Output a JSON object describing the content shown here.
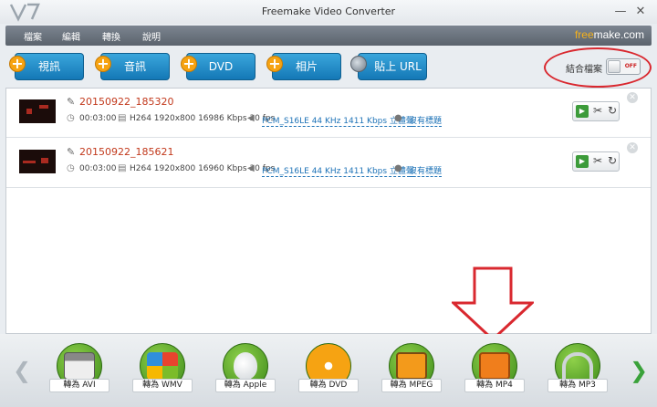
{
  "window": {
    "title": "Freemake Video Converter",
    "minimize": "—",
    "close": "✕"
  },
  "brand": {
    "part1": "free",
    "part2": "make.com"
  },
  "menu": {
    "items": [
      "檔案",
      "編輯",
      "轉換",
      "說明"
    ]
  },
  "sources": [
    {
      "label": "視訊"
    },
    {
      "label": "音訊"
    },
    {
      "label": "DVD"
    },
    {
      "label": "相片"
    },
    {
      "label": "貼上 URL"
    }
  ],
  "join": {
    "label": "結合檔案",
    "state": "OFF"
  },
  "files": [
    {
      "name": "20150922_185320",
      "duration": "00:03:00",
      "video": "H264  1920x800  16986 Kbps  30 fps",
      "audio": "PCM_S16LE  44 KHz  1411 Kbps  立體聲",
      "subtitle": "沒有標題"
    },
    {
      "name": "20150922_185621",
      "duration": "00:03:00",
      "video": "H264  1920x800  16960 Kbps  30 fps",
      "audio": "PCM_S16LE  44 KHz  1411 Kbps  立體聲",
      "subtitle": "沒有標題"
    }
  ],
  "outputs": [
    {
      "label": "轉為 AVI",
      "icon": "avi-clapper-icon"
    },
    {
      "label": "轉為 WMV",
      "icon": "wmv-windows-icon"
    },
    {
      "label": "轉為 Apple",
      "icon": "apple-icon"
    },
    {
      "label": "轉為 DVD",
      "icon": "dvd-disc-icon"
    },
    {
      "label": "轉為 MPEG",
      "icon": "mpeg-tv-icon"
    },
    {
      "label": "轉為 MP4",
      "icon": "mp4-film-icon"
    },
    {
      "label": "轉為 MP3",
      "icon": "mp3-headphones-icon"
    }
  ],
  "colors": {
    "accent_blue": "#1e73b7",
    "file_name": "#c2391c",
    "annotation": "#d9282f",
    "brand_orange": "#f7b219"
  }
}
